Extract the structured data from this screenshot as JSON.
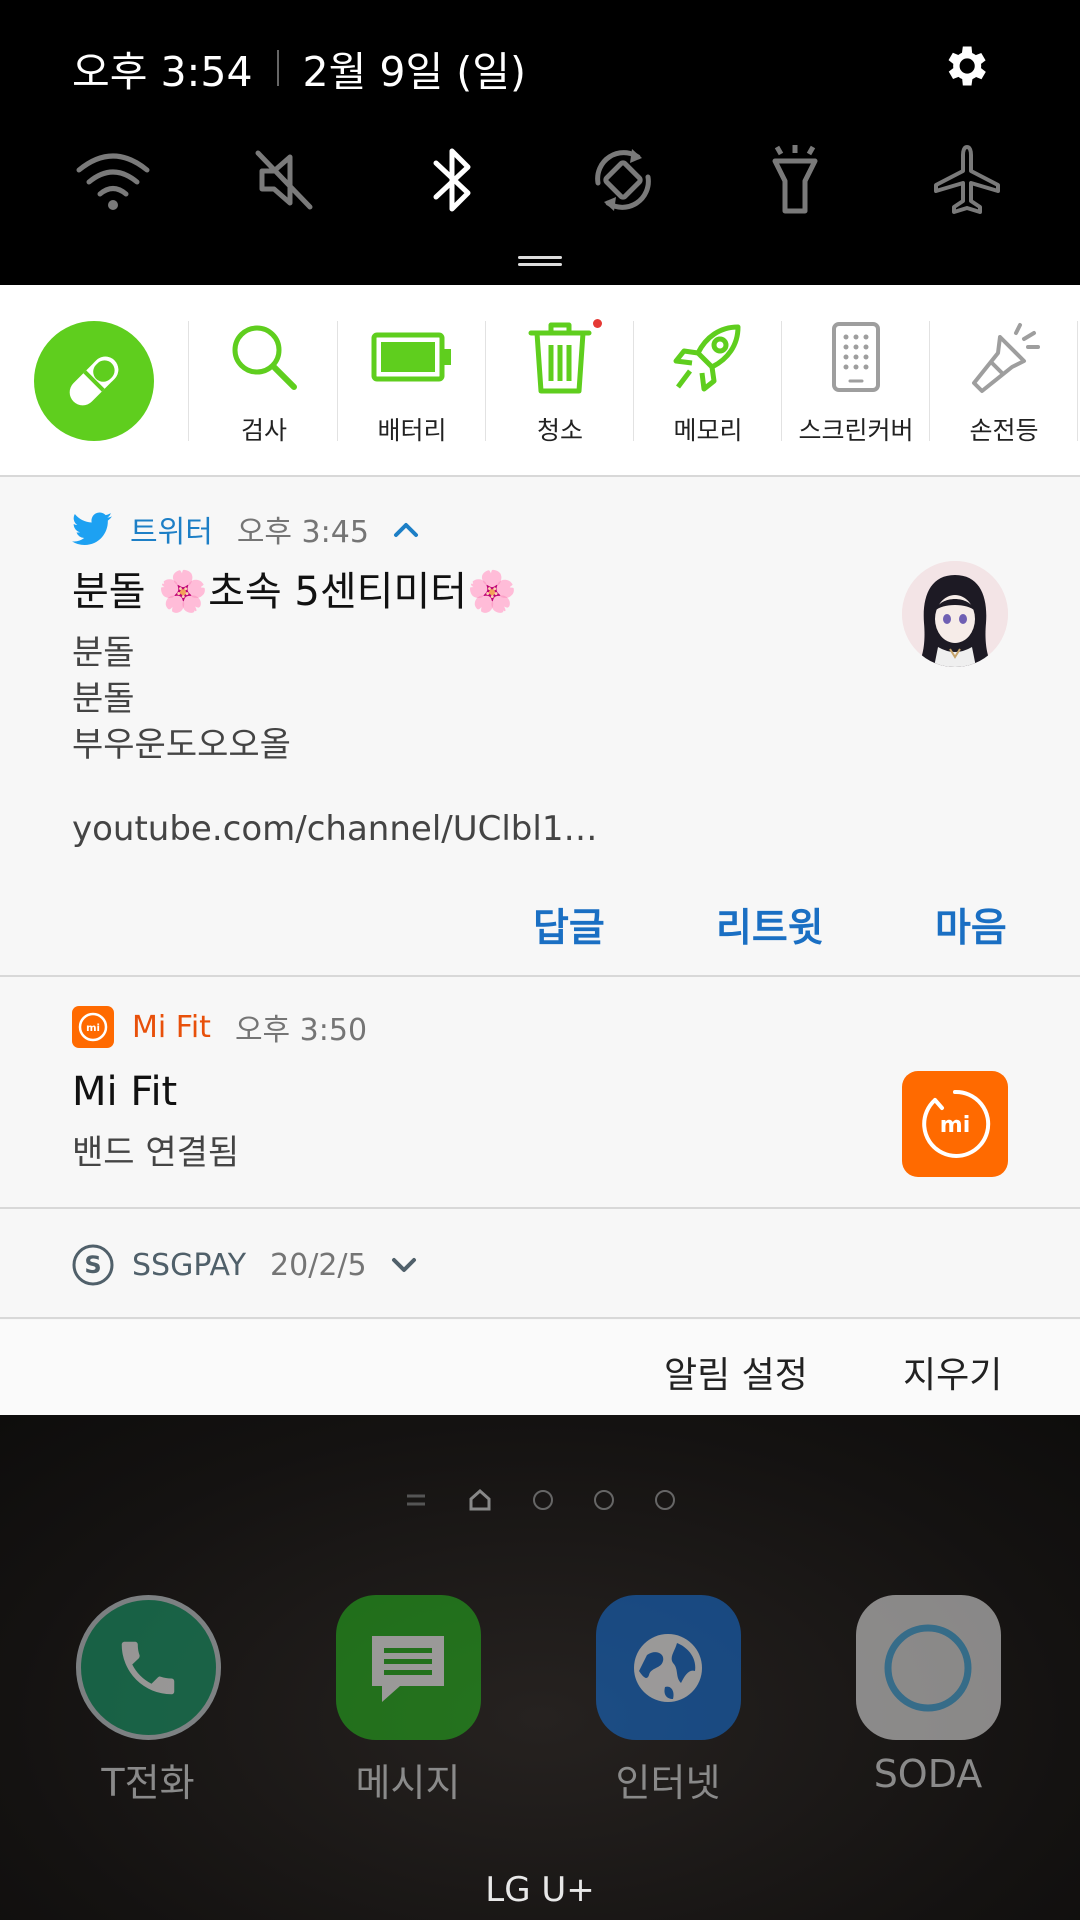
{
  "status_bar": {
    "time": "오후 3:54",
    "date": "2월 9일 (일)"
  },
  "quick_settings": [
    {
      "icon": "wifi-icon",
      "state": "off"
    },
    {
      "icon": "mute-icon",
      "state": "off"
    },
    {
      "icon": "bluetooth-icon",
      "state": "on"
    },
    {
      "icon": "auto-rotate-icon",
      "state": "off"
    },
    {
      "icon": "flashlight-icon",
      "state": "off"
    },
    {
      "icon": "airplane-icon",
      "state": "off"
    }
  ],
  "cleaner_toolbar": {
    "accent_color": "#5fce1e",
    "tools": [
      {
        "label": "검사",
        "icon": "magnifier-icon"
      },
      {
        "label": "배터리",
        "icon": "battery-icon"
      },
      {
        "label": "청소",
        "icon": "trash-icon",
        "has_badge": true
      },
      {
        "label": "메모리",
        "icon": "rocket-icon"
      },
      {
        "label": "스크린커버",
        "icon": "phone-screen-icon"
      },
      {
        "label": "손전등",
        "icon": "torch-icon"
      }
    ]
  },
  "twitter_notification": {
    "app_name": "트위터",
    "time": "오후 3:45",
    "title": "분돌 🌸초속 5센티미터🌸",
    "lines": [
      "분돌",
      "분돌",
      "부우운도오오올",
      "",
      "youtube.com/channel/UClbl1…"
    ],
    "actions": [
      "답글",
      "리트윗",
      "마음"
    ],
    "accent_color": "#1da1f2"
  },
  "mifit_notification": {
    "app_name": "Mi Fit",
    "time": "오후 3:50",
    "title": "Mi Fit",
    "body": "밴드 연결됨",
    "accent_color": "#ff6a00"
  },
  "ssgpay_notification": {
    "app_name": "SSGPAY",
    "time": "20/2/5"
  },
  "footer": {
    "notification_settings": "알림 설정",
    "clear": "지우기"
  },
  "home_dock": [
    {
      "label": "T전화",
      "icon": "phone-icon",
      "color": "#1aa06e"
    },
    {
      "label": "메시지",
      "icon": "message-icon",
      "color": "#26b51e"
    },
    {
      "label": "인터넷",
      "icon": "globe-icon",
      "color": "#1670d6"
    },
    {
      "label": "SODA",
      "icon": "soda-icon",
      "color": "#e8e8e8"
    }
  ],
  "carrier": "LG U+"
}
